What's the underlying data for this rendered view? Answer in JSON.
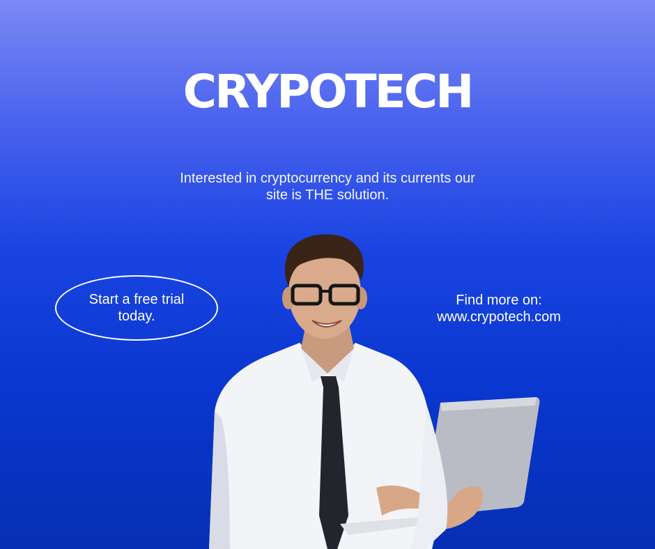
{
  "brand": {
    "title": "CRYPOTECH"
  },
  "tagline": {
    "line1": "Interested in cryptocurrency and its currents our",
    "line2": "site is THE solution."
  },
  "cta": {
    "line1": "Start a free trial",
    "line2": "today."
  },
  "find_more": {
    "label": "Find more on:",
    "url": "www.crypotech.com"
  },
  "colors": {
    "background_top": "#7b89f4",
    "background_bottom": "#0530b4",
    "text": "#ffffff"
  },
  "image": {
    "subject": "person-with-laptop"
  }
}
